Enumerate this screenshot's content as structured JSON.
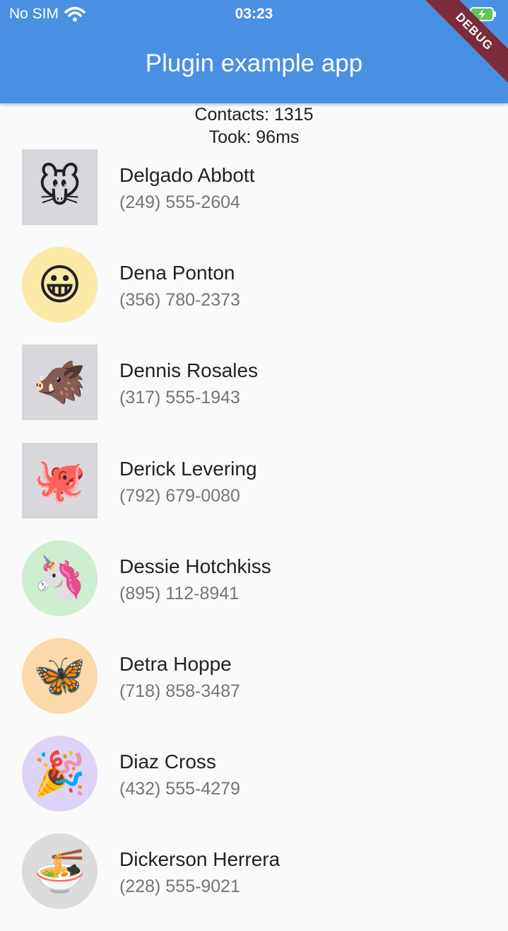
{
  "status_bar": {
    "carrier": "No SIM",
    "time": "03:23",
    "wifi_icon": "wifi-icon",
    "battery_icon": "battery-charging-icon"
  },
  "app_bar": {
    "title": "Plugin example app",
    "banner": "DEBUG",
    "color": "#4a90e2",
    "banner_color": "#7b2b39"
  },
  "stats": {
    "contacts": "Contacts: 1315",
    "took": "Took: 96ms"
  },
  "contacts": [
    {
      "name": "Delgado Abbott",
      "phone": "(249) 555-2604",
      "avatar_icon": "mouse-face-icon",
      "avatar_glyph": "🐭",
      "shape": "square",
      "bg": "#d8d8dc"
    },
    {
      "name": "Dena Ponton",
      "phone": "(356) 780-2373",
      "avatar_icon": "grinning-face-icon",
      "avatar_glyph": "😀",
      "shape": "round",
      "bg": "#fbe9a8"
    },
    {
      "name": "Dennis Rosales",
      "phone": "(317) 555-1943",
      "avatar_icon": "boar-icon",
      "avatar_glyph": "🐗",
      "shape": "square",
      "bg": "#d8d8dc"
    },
    {
      "name": "Derick Levering",
      "phone": "(792) 679-0080",
      "avatar_icon": "octopus-icon",
      "avatar_glyph": "🐙",
      "shape": "square",
      "bg": "#d8d8dc"
    },
    {
      "name": "Dessie Hotchkiss",
      "phone": "(895) 112-8941",
      "avatar_icon": "unicorn-icon",
      "avatar_glyph": "🦄",
      "shape": "round",
      "bg": "#cdeecf"
    },
    {
      "name": "Detra Hoppe",
      "phone": "(718) 858-3487",
      "avatar_icon": "butterfly-icon",
      "avatar_glyph": "🦋",
      "shape": "round",
      "bg": "#fbd9a8"
    },
    {
      "name": "Diaz Cross",
      "phone": "(432) 555-4279",
      "avatar_icon": "party-popper-icon",
      "avatar_glyph": "🎉",
      "shape": "round",
      "bg": "#dcd3f7"
    },
    {
      "name": "Dickerson Herrera",
      "phone": "(228) 555-9021",
      "avatar_icon": "noodle-bowl-icon",
      "avatar_glyph": "🍜",
      "shape": "round",
      "bg": "#dcdcdc"
    }
  ]
}
